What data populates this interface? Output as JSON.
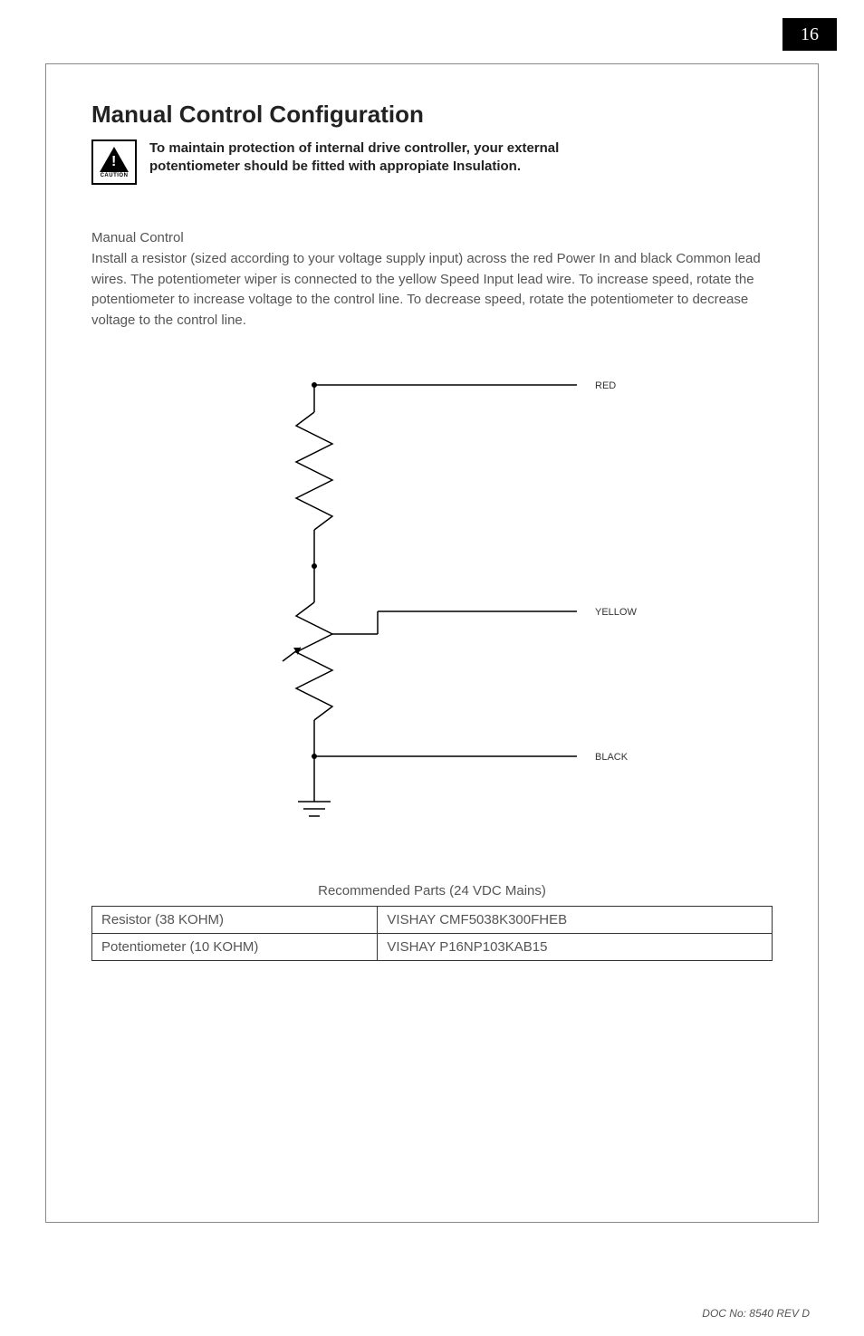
{
  "page_number": "16",
  "heading": "Manual Control Configuration",
  "caution_label": "CAUTION",
  "warning_text_line1": "To maintain protection of internal drive controller, your external",
  "warning_text_line2": "potentiometer should be fitted with appropiate Insulation.",
  "section_label": "Manual Control",
  "body_text": "Install a resistor (sized according to your voltage supply input) across the red Power In and black Common lead wires. The potentiometer wiper is connected to the yellow Speed Input lead wire. To increase speed, rotate the potentiometer to increase voltage to the control line.  To decrease speed, rotate the potentiometer to decrease voltage to the control line.",
  "schematic": {
    "wire_red": "RED",
    "wire_yellow": "YELLOW",
    "wire_black": "BLACK"
  },
  "table_caption": "Recommended Parts (24 VDC Mains)",
  "parts_table": {
    "row1_col1": "Resistor (38 KOHM)",
    "row1_col2": "VISHAY CMF5038K300FHEB",
    "row2_col1": "Potentiometer (10 KOHM)",
    "row2_col2": "VISHAY P16NP103KAB15"
  },
  "footer": "DOC No: 8540 REV D"
}
